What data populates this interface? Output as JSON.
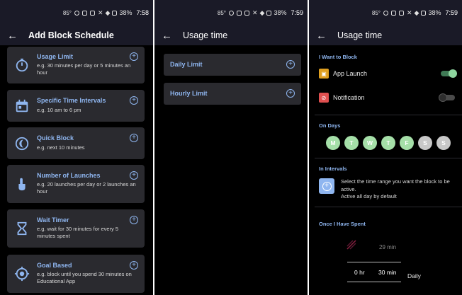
{
  "status_bars": [
    {
      "temp": "85°",
      "battery": "38%",
      "time": "7:58"
    },
    {
      "temp": "85°",
      "battery": "38%",
      "time": "7:59"
    },
    {
      "temp": "85°",
      "battery": "38%",
      "time": "7:59"
    }
  ],
  "screen1": {
    "title": "Add Block Schedule",
    "cards": [
      {
        "title": "Usage Limit",
        "desc": "e.g. 30 minutes per day or 5 minutes an hour",
        "icon": "stopwatch-icon"
      },
      {
        "title": "Specific Time Intervals",
        "desc": "e.g. 10 am to 6 pm",
        "icon": "calendar-icon"
      },
      {
        "title": "Quick Block",
        "desc": "e.g. next 10 minutes",
        "icon": "moon-clock-icon"
      },
      {
        "title": "Number of Launches",
        "desc": "e.g. 20 launches per day or 2 launches an hour",
        "icon": "tap-hand-icon"
      },
      {
        "title": "Wait Timer",
        "desc": "e.g. wait for 30 minutes for every 5 minutes spent",
        "icon": "hourglass-icon"
      },
      {
        "title": "Goal Based",
        "desc": "e.g. block until you spend 30 minutes on Educational App",
        "icon": "target-icon"
      }
    ]
  },
  "screen2": {
    "title": "Usage time",
    "items": [
      {
        "label": "Daily Limit"
      },
      {
        "label": "Hourly Limit"
      }
    ]
  },
  "screen3": {
    "title": "Usage time",
    "want_to_block": {
      "label": "I Want to Block",
      "apps": [
        {
          "name": "App Launch",
          "enabled": true
        },
        {
          "name": "Notification",
          "enabled": false
        }
      ]
    },
    "on_days": {
      "label": "On Days",
      "days": [
        {
          "letter": "M",
          "selected": true
        },
        {
          "letter": "T",
          "selected": true
        },
        {
          "letter": "W",
          "selected": true
        },
        {
          "letter": "T",
          "selected": true
        },
        {
          "letter": "F",
          "selected": true
        },
        {
          "letter": "S",
          "selected": false
        },
        {
          "letter": "S",
          "selected": false
        }
      ]
    },
    "in_intervals": {
      "label": "In Intervals",
      "text": "Select the time range you want the block to be active.",
      "subtext": "Active all day by default"
    },
    "once_spent": {
      "label": "Once I Have Spent",
      "previous_minutes": "29 min",
      "hours": "0 hr",
      "minutes": "30 min",
      "period": "Daily"
    }
  },
  "colors": {
    "accent": "#8fb6f0",
    "card_bg": "#2a2a2f",
    "bar_bg": "#1a1a27",
    "day_selected": "#a5dfa8"
  }
}
